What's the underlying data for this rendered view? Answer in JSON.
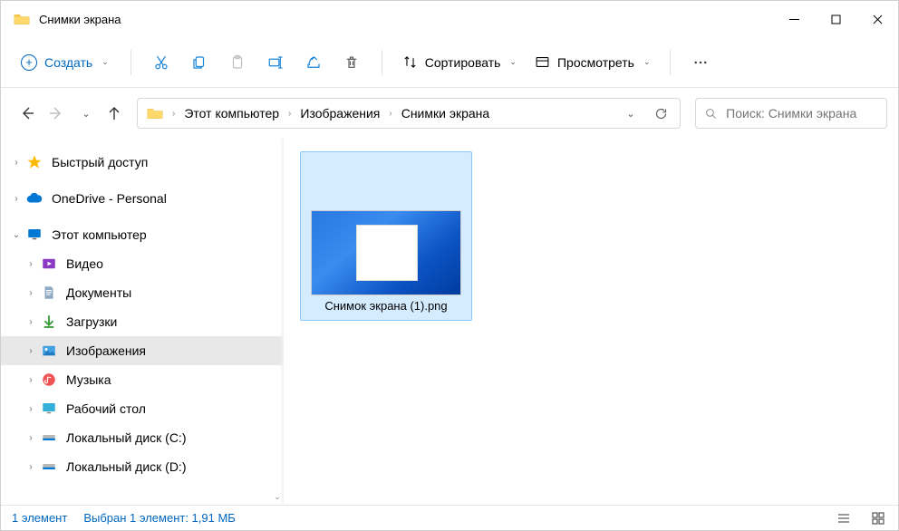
{
  "window": {
    "title": "Снимки экрана"
  },
  "toolbar": {
    "create": "Создать",
    "sort": "Сортировать",
    "view": "Просмотреть"
  },
  "breadcrumbs": [
    "Этот компьютер",
    "Изображения",
    "Снимки экрана"
  ],
  "search": {
    "placeholder": "Поиск: Снимки экрана"
  },
  "sidebar": {
    "quick_access": "Быстрый доступ",
    "onedrive": "OneDrive - Personal",
    "this_pc": "Этот компьютер",
    "videos": "Видео",
    "documents": "Документы",
    "downloads": "Загрузки",
    "pictures": "Изображения",
    "music": "Музыка",
    "desktop": "Рабочий стол",
    "disk_c": "Локальный диск (C:)",
    "disk_d": "Локальный диск (D:)"
  },
  "files": [
    {
      "name": "Снимок экрана (1).png"
    }
  ],
  "status": {
    "count": "1 элемент",
    "selected": "Выбран 1 элемент: 1,91 МБ"
  }
}
